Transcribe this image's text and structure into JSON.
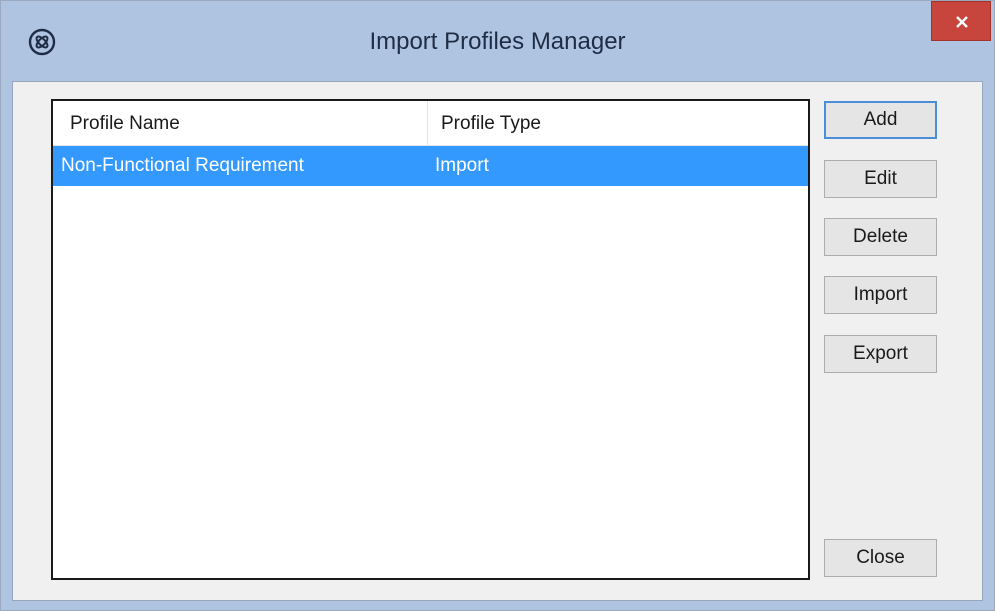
{
  "window": {
    "title": "Import Profiles Manager",
    "icon": "app-logo-icon",
    "close_icon": "close-icon"
  },
  "table": {
    "columns": [
      "Profile Name",
      "Profile Type"
    ],
    "rows": [
      {
        "name": "Non-Functional Requirement",
        "type": "Import",
        "selected": true
      }
    ]
  },
  "buttons": {
    "add": "Add",
    "edit": "Edit",
    "delete": "Delete",
    "import": "Import",
    "export": "Export",
    "close": "Close"
  },
  "colors": {
    "selection": "#3399ff",
    "titlebar": "#afc4e0",
    "close_button": "#c8453d"
  }
}
